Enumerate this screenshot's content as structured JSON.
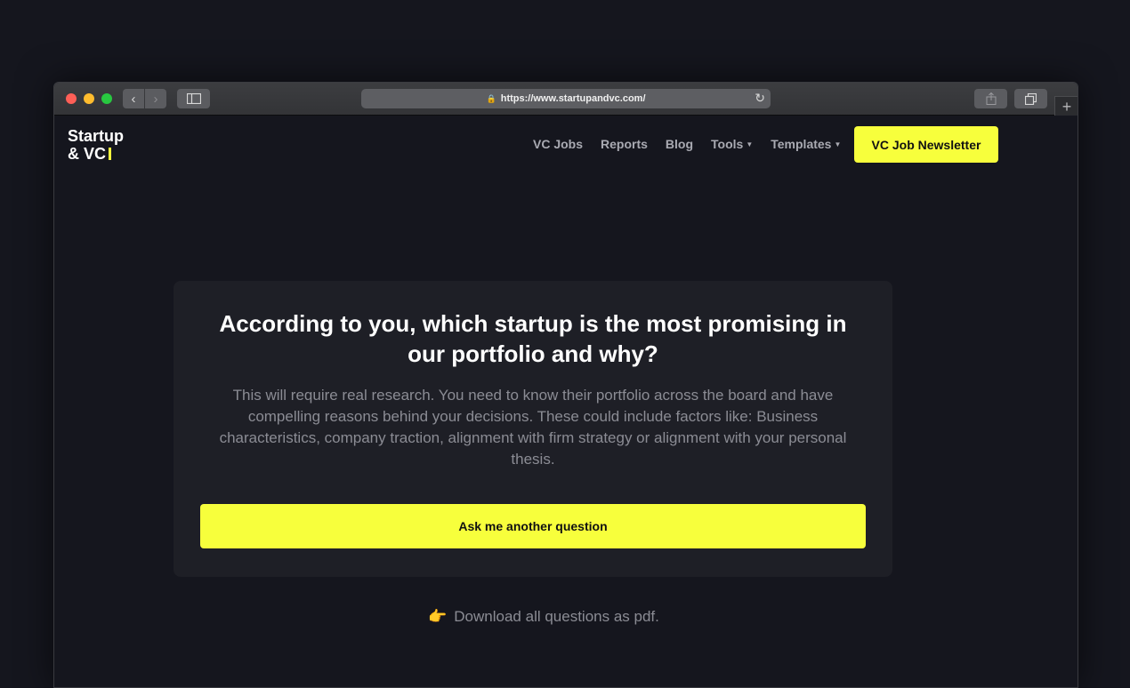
{
  "browser": {
    "url": "https://www.startupandvc.com/"
  },
  "site": {
    "logo_line1": "Startup",
    "logo_line2": "& VC",
    "nav": {
      "vc_jobs": "VC Jobs",
      "reports": "Reports",
      "blog": "Blog",
      "tools": "Tools",
      "templates": "Templates"
    },
    "newsletter_button": "VC Job Newsletter"
  },
  "question_card": {
    "question": "According to you, which startup is the most promising in our portfolio and why?",
    "description": "This will require real research. You need to know their portfolio across the board and have compelling reasons behind your decisions. These could include factors like: Business characteristics, company traction, alignment with firm strategy or alignment with your personal thesis.",
    "ask_button": "Ask me another question"
  },
  "download_link": "Download all questions as pdf.",
  "colors": {
    "accent": "#f7ff3c",
    "background": "#15161e",
    "card": "#1e1f26"
  }
}
